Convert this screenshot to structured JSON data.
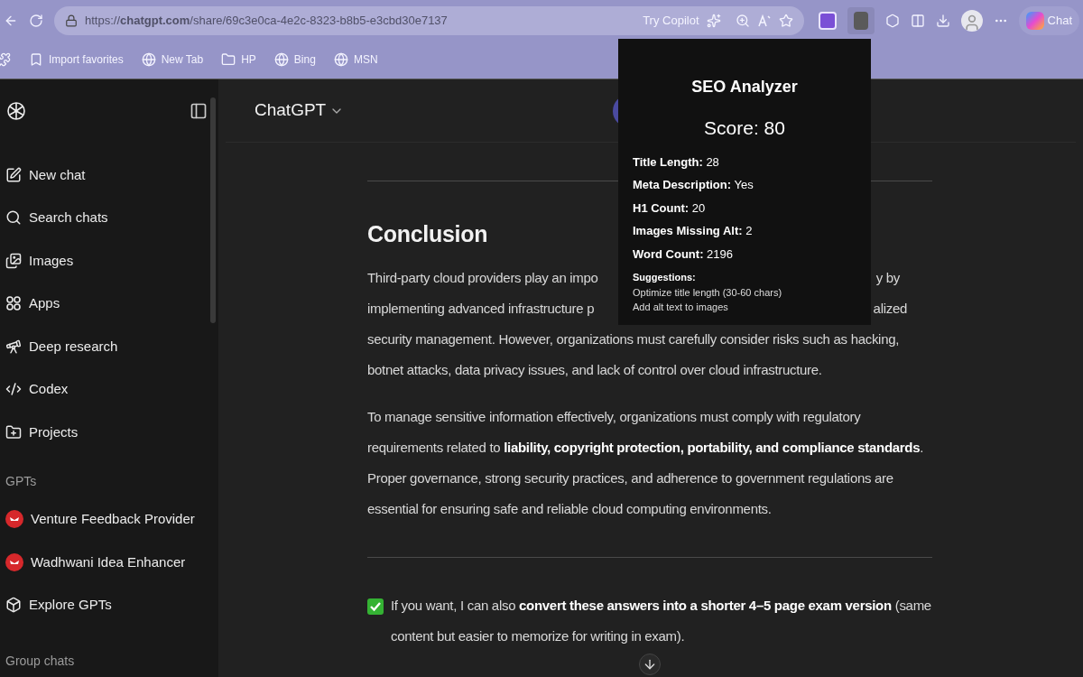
{
  "browser": {
    "url": "https://**chatgpt.com**/share/69c3e0ca-4e2c-8323-b8b5-e3cbd30e7137",
    "try_copilot": "Try Copilot",
    "chat_button": "Chat"
  },
  "bookmarks": [
    {
      "label": "Import favorites",
      "kind": "import"
    },
    {
      "label": "New Tab",
      "kind": "globe"
    },
    {
      "label": "HP",
      "kind": "folder"
    },
    {
      "label": "Bing",
      "kind": "globe"
    },
    {
      "label": "MSN",
      "kind": "globe"
    }
  ],
  "sidebar": {
    "items": [
      {
        "label": "New chat",
        "kind": "new"
      },
      {
        "label": "Search chats",
        "kind": "search"
      },
      {
        "label": "Images",
        "kind": "images"
      },
      {
        "label": "Apps",
        "kind": "apps"
      },
      {
        "label": "Deep research",
        "kind": "research"
      },
      {
        "label": "Codex",
        "kind": "codex"
      },
      {
        "label": "Projects",
        "kind": "projects"
      }
    ],
    "gpts_heading": "GPTs",
    "gpts": [
      {
        "label": "Venture Feedback Provider",
        "kind": "avatar"
      },
      {
        "label": "Wadhwani Idea Enhancer",
        "kind": "avatar"
      },
      {
        "label": "Explore GPTs",
        "kind": "explore"
      }
    ],
    "group_heading": "Group chats"
  },
  "header": {
    "title": "ChatGPT"
  },
  "article": {
    "heading": "Conclusion",
    "line_1": {
      "left": "Third-party cloud providers play an impo",
      "right": "y by"
    },
    "line_2": {
      "left": "implementing advanced infrastructure p",
      "right": "alized"
    },
    "rest": "security management. However, organizations must carefully consider risks such as hacking, botnet attacks, data privacy issues, and lack of control over cloud infrastructure.",
    "paragraph_2": "To manage sensitive information effectively, organizations must comply with regulatory requirements related to **liability, copyright protection, portability, and compliance standards**. Proper governance, strong security practices, and adherence to government regulations are essential for ensuring safe and reliable cloud computing environments.",
    "closing": "If you want, I can also **convert these answers into a shorter 4–5 page exam version** (same content but easier to memorize for writing in exam)."
  },
  "seo": {
    "title": "SEO Analyzer",
    "score": "Score: 80",
    "metrics": [
      {
        "label": "Title Length:",
        "value": "28"
      },
      {
        "label": "Meta Description:",
        "value": "Yes"
      },
      {
        "label": "H1 Count:",
        "value": "20"
      },
      {
        "label": "Images Missing Alt:",
        "value": "2"
      },
      {
        "label": "Word Count:",
        "value": "2196"
      }
    ],
    "suggestions_label": "Suggestions:",
    "suggestions": [
      "Optimize title length (30-60 chars)",
      "Add alt text to images"
    ]
  }
}
